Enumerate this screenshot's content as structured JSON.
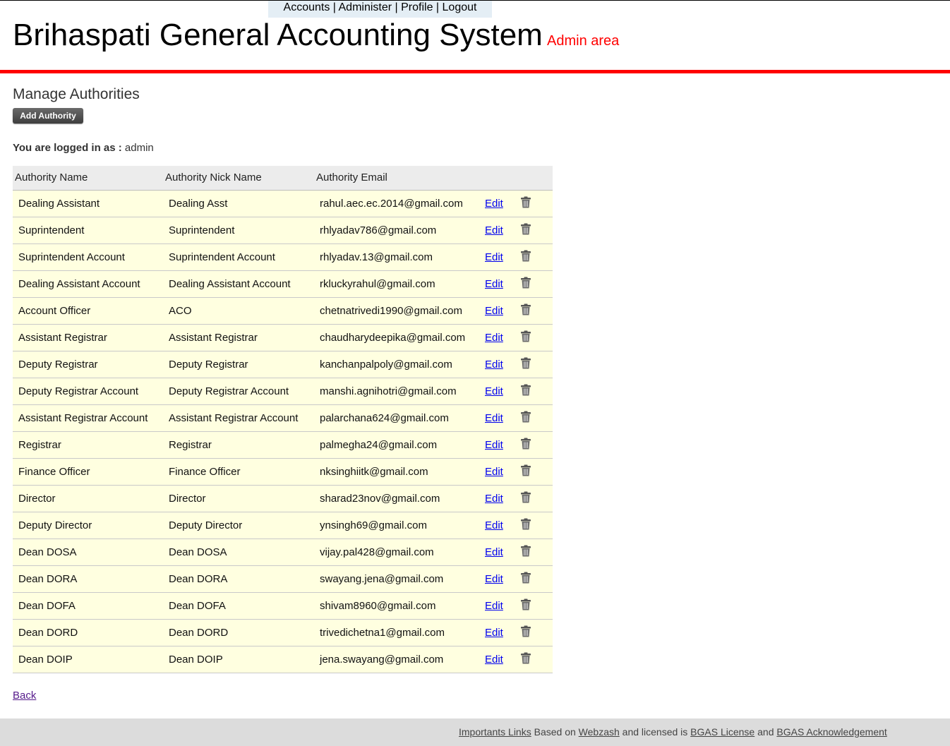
{
  "topnav": {
    "accounts": "Accounts",
    "administer": "Administer",
    "profile": "Profile",
    "logout": "Logout",
    "separator": " | "
  },
  "header": {
    "title": "Brihaspati General Accounting System",
    "subtitle": "Admin area"
  },
  "page": {
    "title": "Manage Authorities",
    "add_button": "Add Authority",
    "logged_label": "You are logged in as :",
    "logged_user": "admin",
    "back_link": "Back"
  },
  "table": {
    "headers": [
      "Authority Name",
      "Authority Nick Name",
      "Authority Email"
    ],
    "edit_label": "Edit",
    "rows": [
      {
        "name": "Dealing Assistant",
        "nick": "Dealing Asst",
        "email": "rahul.aec.ec.2014@gmail.com"
      },
      {
        "name": "Suprintendent",
        "nick": "Suprintendent",
        "email": "rhlyadav786@gmail.com"
      },
      {
        "name": "Suprintendent Account",
        "nick": "Suprintendent Account",
        "email": "rhlyadav.13@gmail.com"
      },
      {
        "name": "Dealing Assistant Account",
        "nick": "Dealing Assistant Account",
        "email": "rkluckyrahul@gmail.com"
      },
      {
        "name": "Account Officer",
        "nick": "ACO",
        "email": "chetnatrivedi1990@gmail.com"
      },
      {
        "name": "Assistant Registrar",
        "nick": "Assistant Registrar",
        "email": "chaudharydeepika@gmail.com"
      },
      {
        "name": "Deputy Registrar",
        "nick": "Deputy Registrar",
        "email": "kanchanpalpoly@gmail.com"
      },
      {
        "name": "Deputy Registrar Account",
        "nick": "Deputy Registrar Account",
        "email": "manshi.agnihotri@gmail.com"
      },
      {
        "name": "Assistant Registrar Account",
        "nick": "Assistant Registrar Account",
        "email": "palarchana624@gmail.com"
      },
      {
        "name": "Registrar",
        "nick": "Registrar",
        "email": "palmegha24@gmail.com"
      },
      {
        "name": "Finance Officer",
        "nick": "Finance Officer",
        "email": "nksinghiitk@gmail.com"
      },
      {
        "name": "Director",
        "nick": "Director",
        "email": "sharad23nov@gmail.com"
      },
      {
        "name": "Deputy Director",
        "nick": "Deputy Director",
        "email": "ynsingh69@gmail.com"
      },
      {
        "name": "Dean DOSA",
        "nick": "Dean DOSA",
        "email": "vijay.pal428@gmail.com"
      },
      {
        "name": "Dean DORA",
        "nick": "Dean DORA",
        "email": "swayang.jena@gmail.com"
      },
      {
        "name": "Dean DOFA",
        "nick": "Dean DOFA",
        "email": "shivam8960@gmail.com"
      },
      {
        "name": "Dean DORD",
        "nick": "Dean DORD",
        "email": "trivedichetna1@gmail.com"
      },
      {
        "name": "Dean DOIP",
        "nick": "Dean DOIP",
        "email": "jena.swayang@gmail.com"
      }
    ]
  },
  "footer": {
    "important_links": "Importants Links",
    "based_on": " Based on ",
    "webzash": "Webzash",
    "licensed": " and licensed is ",
    "license": "BGAS License",
    "and": " and ",
    "ack": "BGAS Acknowledgement"
  },
  "colors": {
    "accent_red": "#ff0000",
    "row_bg": "#ffffe0",
    "link": "#0000ee"
  }
}
